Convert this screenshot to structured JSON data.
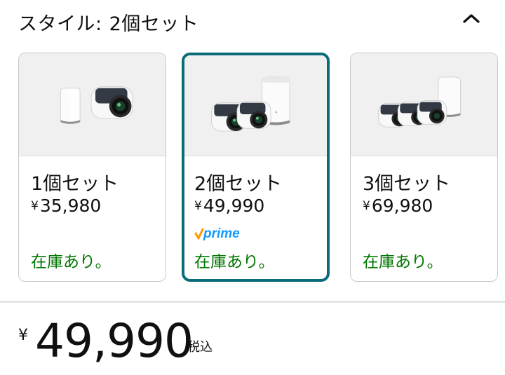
{
  "style_selector": {
    "label": "スタイル:",
    "selected": "2個セット",
    "collapse_icon": "chevron-up-icon"
  },
  "options": [
    {
      "title": "1個セット",
      "currency": "¥",
      "price": "35,980",
      "stock": "在庫あり。",
      "prime": false,
      "selected": false,
      "image": "1-camera-and-base-station"
    },
    {
      "title": "2個セット",
      "currency": "¥",
      "price": "49,990",
      "stock": "在庫あり。",
      "prime": true,
      "selected": true,
      "image": "2-cameras-and-base-station"
    },
    {
      "title": "3個セット",
      "currency": "¥",
      "price": "69,980",
      "stock": "在庫あり。",
      "prime": false,
      "selected": false,
      "image": "3-cameras-and-base-station"
    }
  ],
  "prime_badge": {
    "label": "prime",
    "check_color": "#ff9900",
    "text_color": "#1399ff"
  },
  "price_summary": {
    "currency": "¥",
    "amount": "49,990",
    "tax_note": "税込"
  },
  "colors": {
    "selected_border": "#0a6b7a",
    "stock_green": "#007600",
    "text": "#0f1111"
  }
}
